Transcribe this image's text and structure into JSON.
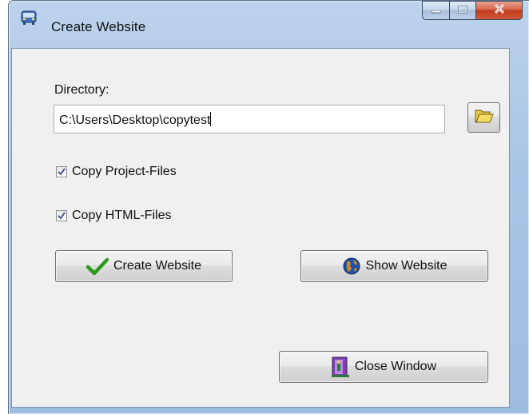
{
  "window": {
    "title": "Create Website",
    "controls": {
      "minimize": "minimize",
      "maximize": "maximize",
      "close": "close"
    }
  },
  "form": {
    "directory_label": "Directory:",
    "directory_value": "C:\\Users\\Desktop\\copytest",
    "browse_icon": "folder-open-icon",
    "copy_project_files": {
      "label": "Copy Project-Files",
      "checked": true
    },
    "copy_html_files": {
      "label": "Copy HTML-Files",
      "checked": true
    }
  },
  "buttons": {
    "create_website": {
      "label": "Create Website",
      "icon": "checkmark-icon"
    },
    "show_website": {
      "label": "Show Website",
      "icon": "globe-icon"
    },
    "close_window": {
      "label": "Close Window",
      "icon": "door-exit-icon"
    }
  },
  "colors": {
    "title_bar": "#a9c5e6",
    "close_button": "#c13a1e",
    "client_background": "#f0f0f0",
    "checkmark": "#2c9a1c"
  }
}
